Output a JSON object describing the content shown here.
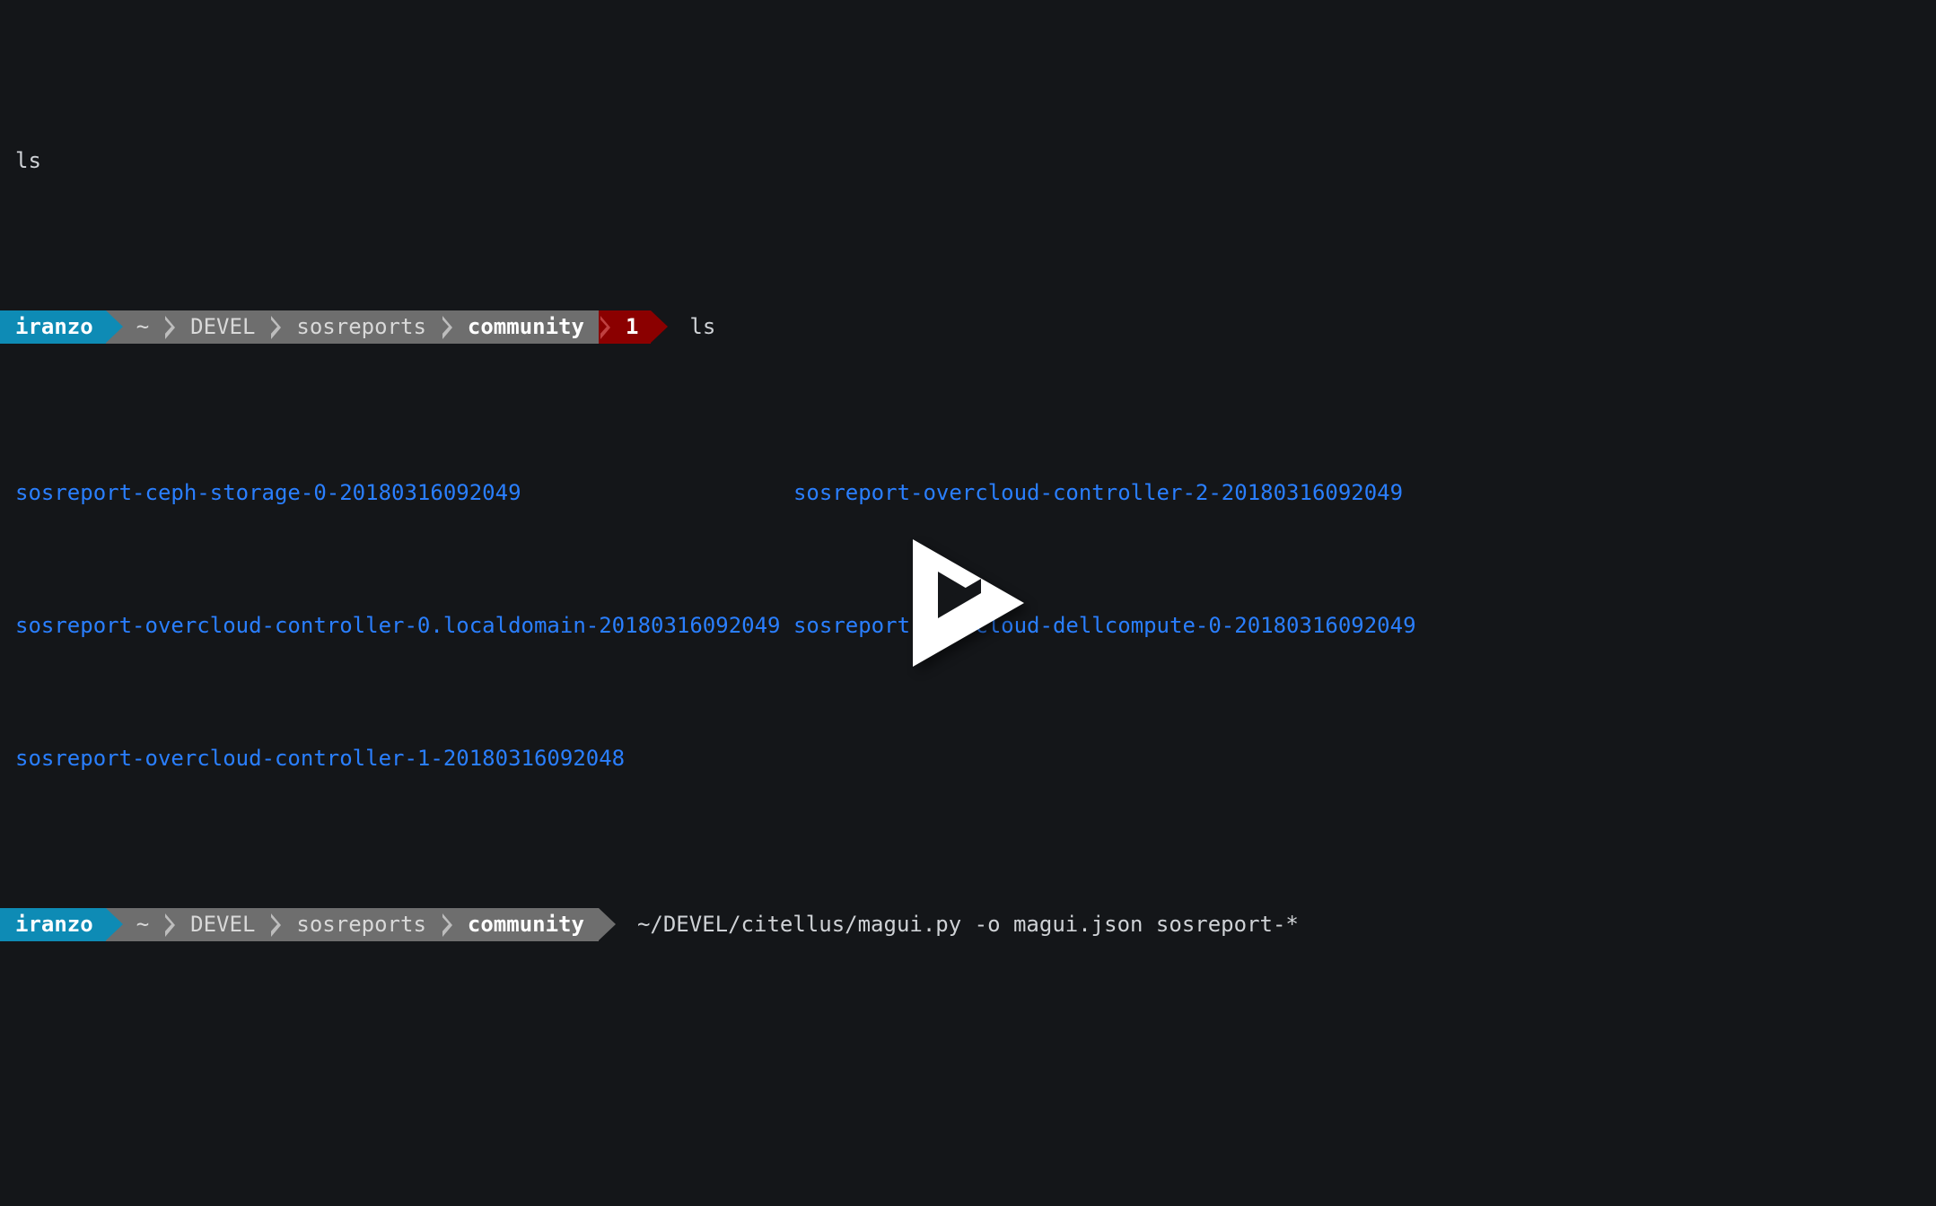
{
  "player": {
    "play_icon": "asciinema-play-icon",
    "state": "paused",
    "background_color": "#141619",
    "icon_color": "#ffffff"
  },
  "terminal": {
    "font_size_px": 24,
    "colors": {
      "background": "#141619",
      "foreground": "#cfd2d6",
      "blue": "#2a7fff",
      "user_segment": "#0e8bb5",
      "path_segment": "#6e6e6e",
      "exit_segment": "#8b0000",
      "white": "#ffffff"
    },
    "scrollback_line": "ls",
    "prompt1": {
      "user": "iranzo",
      "path_segments": [
        "~",
        "DEVEL",
        "sosreports",
        "community"
      ],
      "exit_code": "1",
      "command": "ls"
    },
    "ls_output": [
      {
        "col1": "sosreport-ceph-storage-0-20180316092049",
        "col2": "sosreport-overcloud-controller-2-20180316092049"
      },
      {
        "col1": "sosreport-overcloud-controller-0.localdomain-20180316092049",
        "col2": "sosreport-overcloud-dellcompute-0-20180316092049"
      },
      {
        "col1": "sosreport-overcloud-controller-1-20180316092048",
        "col2": ""
      }
    ],
    "prompt2": {
      "user": "iranzo",
      "path_segments": [
        "~",
        "DEVEL",
        "sosreports",
        "community"
      ],
      "exit_code": null,
      "command": "~/DEVEL/citellus/magui.py -o magui.json sosreport-*"
    }
  }
}
